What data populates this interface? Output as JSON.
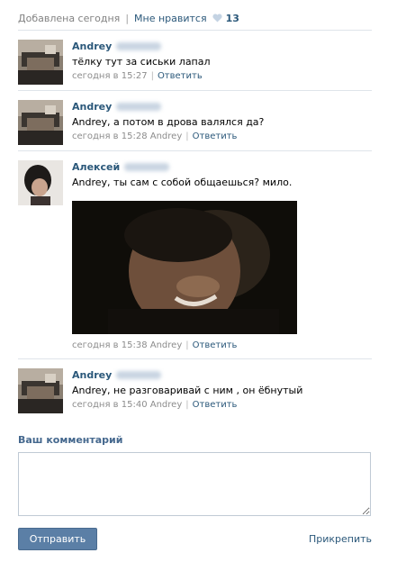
{
  "topbar": {
    "added": "Добавлена сегодня",
    "separator": "|",
    "like_label": "Мне нравится",
    "like_count": "13"
  },
  "comments": [
    {
      "author": "Andrey",
      "text": "тёлку тут за сиськи лапал",
      "time": "сегодня в 15:27",
      "reply_to": "",
      "action": "Ответить"
    },
    {
      "author": "Andrey",
      "text": "Andrey, а потом в дрова валялся да?",
      "time": "сегодня в 15:28",
      "reply_to": "Andrey",
      "action": "Ответить"
    },
    {
      "author": "Алексей",
      "text": "Andrey, ты сам с собой общаешься? мило.",
      "time": "сегодня в 15:38",
      "reply_to": "Andrey",
      "action": "Ответить"
    },
    {
      "author": "Andrey",
      "text": "Andrey, не разговаривай с ним , он ёбнутый",
      "time": "сегодня в 15:40",
      "reply_to": "Andrey",
      "action": "Ответить"
    }
  ],
  "form": {
    "title": "Ваш комментарий",
    "textarea_value": "",
    "send_label": "Отправить",
    "attach_label": "Прикрепить"
  },
  "colors": {
    "link": "#2b587a",
    "meta": "#8c8c8c",
    "button": "#5b7fa6"
  }
}
